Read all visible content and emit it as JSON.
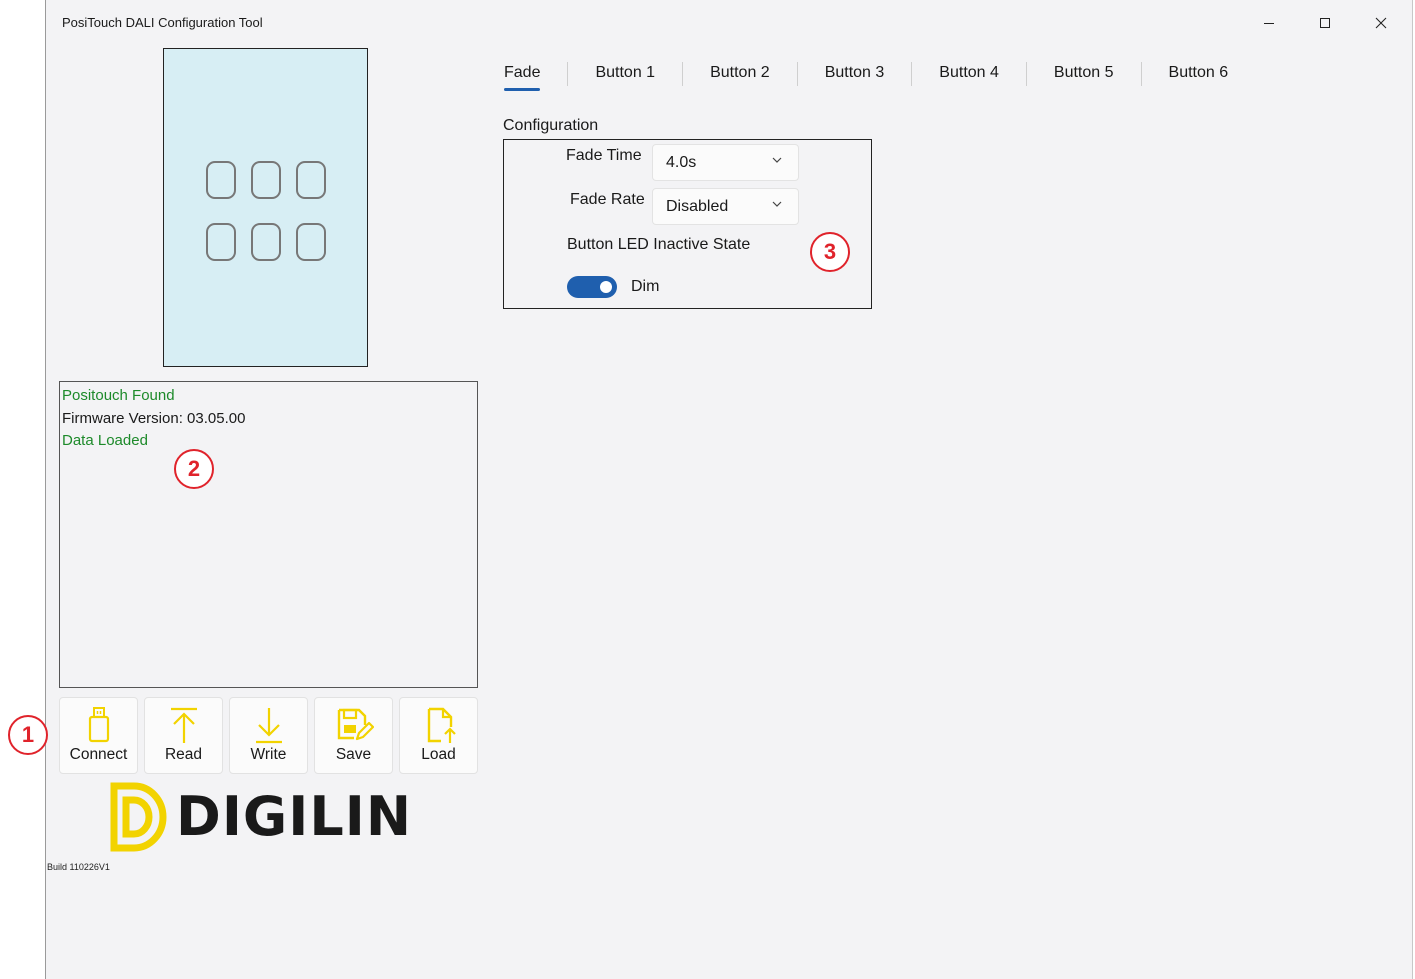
{
  "window": {
    "title": "PosiTouch DALI Configuration Tool"
  },
  "log": {
    "lines": [
      {
        "text": "Positouch Found",
        "color": "#1d8a2a"
      },
      {
        "text": "Firmware Version: 03.05.00",
        "color": "#1a1a1a"
      },
      {
        "text": "Data Loaded",
        "color": "#1d8a2a"
      }
    ]
  },
  "toolbar": {
    "connect": {
      "label": "Connect",
      "icon": "usb-drive-icon"
    },
    "read": {
      "label": "Read",
      "icon": "upload-arrow-icon"
    },
    "write": {
      "label": "Write",
      "icon": "download-arrow-icon"
    },
    "save": {
      "label": "Save",
      "icon": "floppy-edit-icon"
    },
    "load": {
      "label": "Load",
      "icon": "file-upload-icon"
    },
    "icon_color": "#f2d300"
  },
  "logo": {
    "text": "DIGILIN",
    "accent": "#f2d300"
  },
  "build": "Build 110226V1",
  "tabs": [
    "Fade",
    "Button 1",
    "Button 2",
    "Button 3",
    "Button 4",
    "Button 5",
    "Button 6"
  ],
  "active_tab": "Fade",
  "config": {
    "section_label": "Configuration",
    "fade_time": {
      "label": "Fade Time",
      "value": "4.0s"
    },
    "fade_rate": {
      "label": "Fade Rate",
      "value": "Disabled"
    },
    "led_state": {
      "label": "Button LED Inactive State",
      "toggle_on": true,
      "toggle_label": "Dim"
    }
  },
  "callouts": [
    "1",
    "2",
    "3"
  ],
  "colors": {
    "accent": "#1f5fae",
    "callout": "#e0232b",
    "status_ok": "#1d8a2a"
  }
}
